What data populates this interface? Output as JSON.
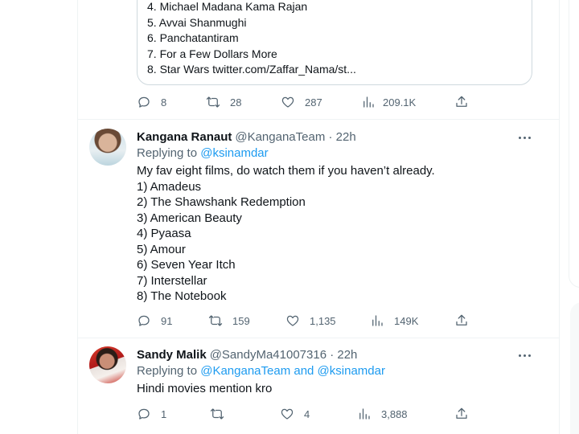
{
  "quote": {
    "lines": [
      "4. Michael Madana Kama Rajan",
      "5. Avvai Shanmughi",
      "6. Panchatantiram",
      "7. For a Few Dollars More",
      "8. Star Wars twitter.com/Zaffar_Nama/st..."
    ]
  },
  "tweet0_actions": {
    "replies": "8",
    "retweets": "28",
    "likes": "287",
    "views": "209.1K"
  },
  "tweet1": {
    "name": "Kangana Ranaut",
    "handle": "@KanganaTeam · 22h",
    "replying_prefix": "Replying to ",
    "replying_to": "@ksinamdar",
    "lines": [
      "My fav eight films, do watch them if you haven’t already.",
      "1) Amadeus",
      "2) The Shawshank Redemption",
      "3) American Beauty",
      "4) Pyaasa",
      "5) Amour",
      "6) Seven Year Itch",
      "7) Interstellar",
      "8) The Notebook"
    ],
    "actions": {
      "replies": "91",
      "retweets": "159",
      "likes": "1,135",
      "views": "149K"
    }
  },
  "tweet2": {
    "name": "Sandy Malik",
    "handle": "@SandyMa41007316 · 22h",
    "replying_prefix": "Replying to ",
    "replying_to": "@KanganaTeam and @ksinamdar",
    "lines": [
      "Hindi movies mention kro"
    ],
    "actions": {
      "replies": "1",
      "retweets": "",
      "likes": "4",
      "views": "3,888"
    }
  },
  "icons": [
    "reply-icon",
    "retweet-icon",
    "like-icon",
    "views-icon",
    "share-icon",
    "more-icon"
  ],
  "colors": {
    "link": "#1d9bf0",
    "secondary_text": "#536471",
    "text": "#0f1419",
    "border": "#eff3f4"
  }
}
